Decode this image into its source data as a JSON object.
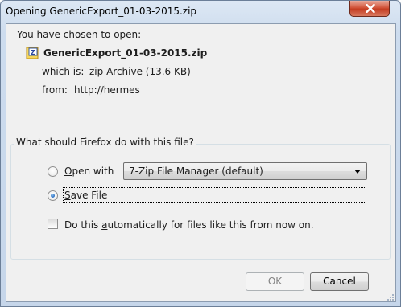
{
  "window": {
    "title": "Opening GenericExport_01-03-2015.zip"
  },
  "intro": {
    "text": "You have chosen to open:"
  },
  "file": {
    "name": "GenericExport_01-03-2015.zip",
    "type_label": "which is:",
    "type_value": "zip Archive (13.6 KB)",
    "from_label": "from:",
    "from_value": "http://hermes",
    "icon": "zip-file-icon"
  },
  "action_group": {
    "legend": "What should Firefox do with this file?",
    "open_with": {
      "label_prefix": "",
      "label_accel": "O",
      "label_rest": "pen with",
      "selected": false,
      "app": "7-Zip File Manager (default)"
    },
    "save_file": {
      "label_accel": "S",
      "label_rest": "ave File",
      "selected": true
    },
    "auto": {
      "label_before": "Do this ",
      "label_accel": "a",
      "label_rest": "utomatically for files like this from now on.",
      "checked": false
    }
  },
  "buttons": {
    "ok": "OK",
    "cancel": "Cancel"
  }
}
